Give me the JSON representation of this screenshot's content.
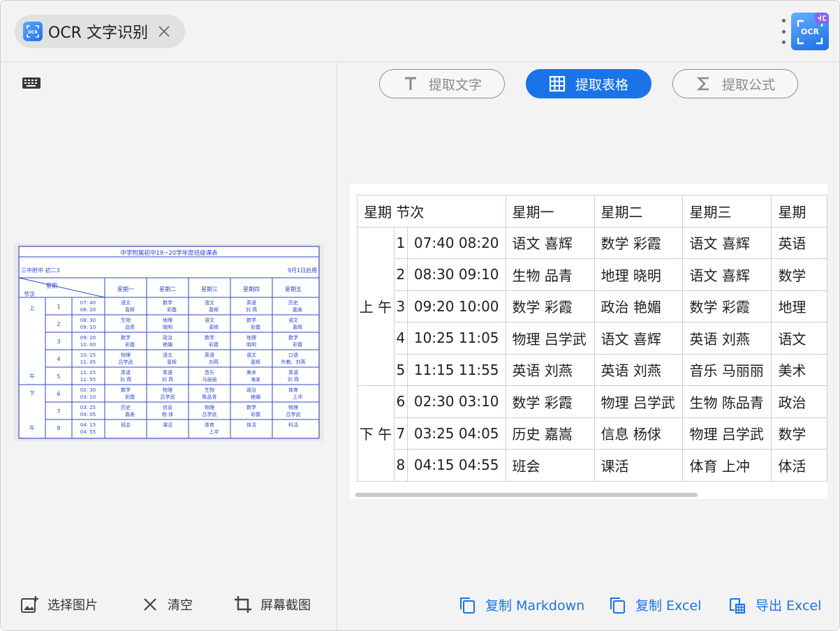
{
  "tab": {
    "title": "OCR 文字识别"
  },
  "modes": [
    {
      "label": "提取文字",
      "active": false
    },
    {
      "label": "提取表格",
      "active": true
    },
    {
      "label": "提取公式",
      "active": false
    }
  ],
  "thumbnail": {
    "title": "中学附属初中19~20学年度班级课表",
    "left_info": "三中附中  初二3",
    "right_info": "9月1日启用",
    "header_period": "星期",
    "header_section": "节次"
  },
  "left_actions": {
    "select_image": "选择图片",
    "clear": "清空",
    "screenshot": "屏幕截图"
  },
  "table": {
    "header": [
      "星期 节次",
      "星期一",
      "星期二",
      "星期三",
      "星期"
    ],
    "groups": [
      {
        "label": "上 午",
        "rows": [
          {
            "n": "1",
            "time": "07:40 08:20",
            "c": [
              "语文 喜辉",
              "数学 彩霞",
              "语文 喜辉",
              "英语"
            ]
          },
          {
            "n": "2",
            "time": "08:30 09:10",
            "c": [
              "生物 品青",
              "地理 晓明",
              "语文 喜辉",
              "数学"
            ]
          },
          {
            "n": "3",
            "time": "09:20 10:00",
            "c": [
              "数学 彩霞",
              "政治 艳媚",
              "数学 彩霞",
              "地理"
            ]
          },
          {
            "n": "4",
            "time": "10:25 11:05",
            "c": [
              "物理 吕学武",
              "语文 喜辉",
              "英语 刘燕",
              "语文"
            ]
          },
          {
            "n": "5",
            "time": "11:15 11:55",
            "c": [
              "英语 刘燕",
              "英语 刘燕",
              "音乐 马丽丽",
              "美术"
            ]
          }
        ]
      },
      {
        "label": "下 午",
        "rows": [
          {
            "n": "6",
            "time": "02:30 03:10",
            "c": [
              "数学 彩霞",
              "物理 吕学武",
              "生物 陈品青",
              "政治"
            ]
          },
          {
            "n": "7",
            "time": "03:25 04:05",
            "c": [
              "历史 嘉嵩",
              "信息 杨俅",
              "物理 吕学武",
              "数学"
            ]
          },
          {
            "n": "8",
            "time": "04:15 04:55",
            "c": [
              "班会",
              "课活",
              "体育 上冲",
              "体活"
            ]
          }
        ]
      }
    ]
  },
  "right_actions": {
    "copy_markdown": "复制 Markdown",
    "copy_excel": "复制 Excel",
    "export_excel": "导出 Excel"
  },
  "colors": {
    "accent": "#1a73e8",
    "border": "#c6d0dc"
  }
}
